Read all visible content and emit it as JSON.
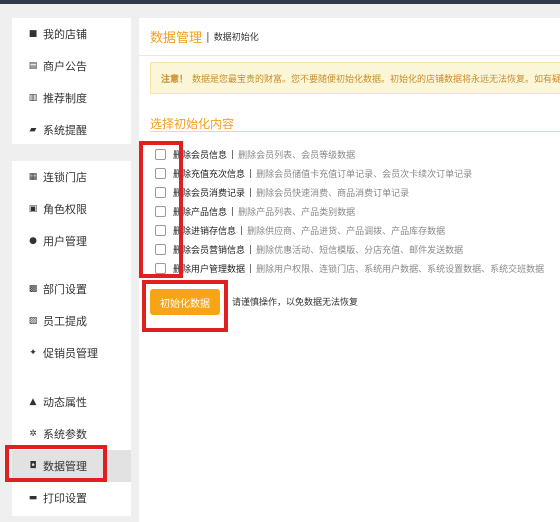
{
  "sidebar": {
    "groups": [
      {
        "items": [
          {
            "label": "我的店铺",
            "icon": "shop-icon"
          },
          {
            "label": "商户公告",
            "icon": "notice-icon"
          },
          {
            "label": "推荐制度",
            "icon": "card-icon"
          },
          {
            "label": "系统提醒",
            "icon": "flag-icon"
          }
        ]
      },
      {
        "items": [
          {
            "label": "连锁门店",
            "icon": "store-icon"
          },
          {
            "label": "角色权限",
            "icon": "role-icon"
          },
          {
            "label": "用户管理",
            "icon": "user-icon"
          }
        ]
      },
      {
        "items": [
          {
            "label": "部门设置",
            "icon": "department-icon"
          },
          {
            "label": "员工提成",
            "icon": "staff-icon"
          },
          {
            "label": "促销员管理",
            "icon": "walker-icon"
          }
        ]
      },
      {
        "items": [
          {
            "label": "动态属性",
            "icon": "attribute-icon"
          },
          {
            "label": "系统参数",
            "icon": "gear-icon"
          },
          {
            "label": "数据管理",
            "icon": "data-icon",
            "active": true
          },
          {
            "label": "打印设置",
            "icon": "printer-icon"
          }
        ]
      }
    ]
  },
  "header": {
    "title": "数据管理",
    "separator": "|",
    "subtitle": "数据初始化"
  },
  "notice": {
    "label": "注意！",
    "text": "数据是您最宝贵的财富。您不要随便初始化数据。初始化的店铺数据将永远无法恢复。如有疑"
  },
  "section": {
    "title": "选择初始化内容"
  },
  "options": [
    {
      "label": "删除会员信息",
      "desc": "删除会员列表、会员等级数据"
    },
    {
      "label": "删除充值充次信息",
      "desc": "删除会员储值卡充值订单记录、会员次卡续次订单记录"
    },
    {
      "label": "删除会员消费记录",
      "desc": "删除会员快速消费、商品消费订单记录"
    },
    {
      "label": "删除产品信息",
      "desc": "删除产品列表、产品类别数据"
    },
    {
      "label": "删除进销存信息",
      "desc": "删除供应商、产品进货、产品调拨、产品库存数据"
    },
    {
      "label": "删除会员营销信息",
      "desc": "删除优惠活动、短信模版、分店充值、邮件发送数据"
    },
    {
      "label": "删除用户管理数据",
      "desc": "删除用户权限、连锁门店、系统用户数据、系统设置数据、系统交班数据"
    }
  ],
  "actions": {
    "init_button": "初始化数据",
    "hint": "请谨慎操作，以免数据无法恢复"
  },
  "colors": {
    "accent": "#f0a020",
    "button": "#f7a517",
    "annotation": "#e02020",
    "notice_bg": "#fcf6d8"
  }
}
